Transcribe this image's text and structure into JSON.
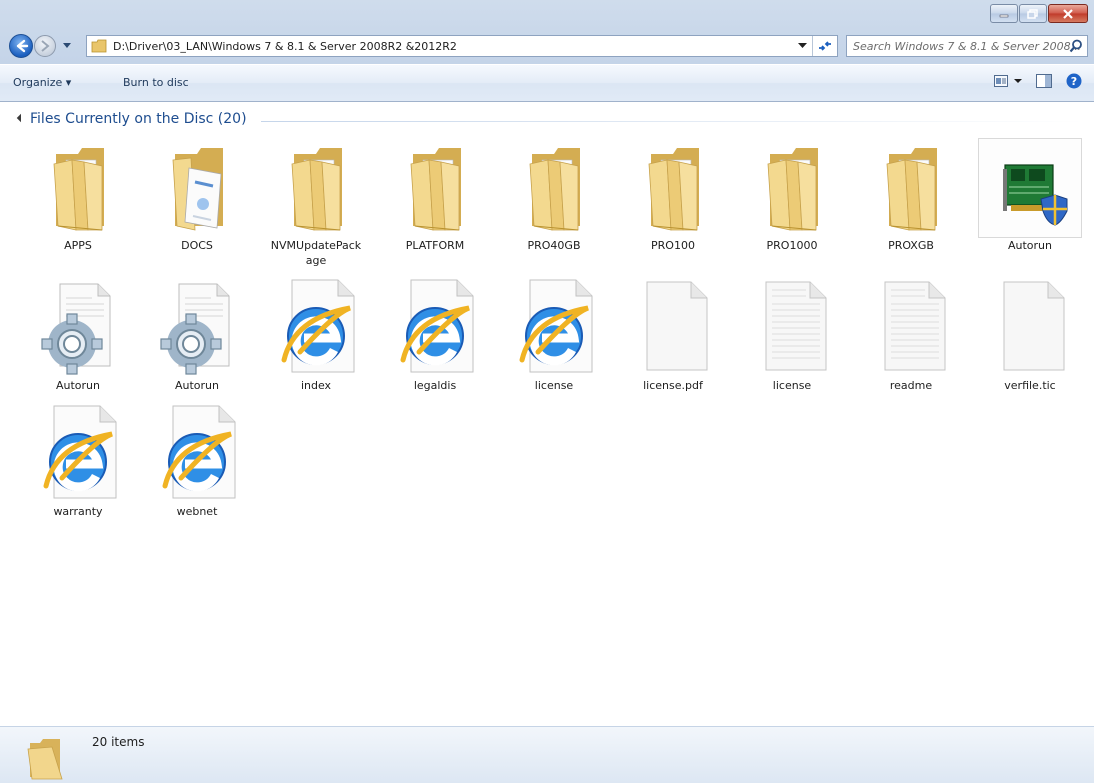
{
  "address": {
    "path": "D:\\Driver\\03_LAN\\Windows 7 & 8.1 & Server 2008R2 &2012R2",
    "search_placeholder": "Search Windows 7 & 8.1 & Server 2008..."
  },
  "toolbar": {
    "organize_label": "Organize ▾",
    "burn_label": "Burn to disc"
  },
  "group": {
    "title": "Files Currently on the Disc (20)"
  },
  "items": [
    {
      "label": "APPS",
      "icon": "folder-icon"
    },
    {
      "label": "DOCS",
      "icon": "folder-docs-icon"
    },
    {
      "label": "NVMUpdatePackage",
      "icon": "folder-icon"
    },
    {
      "label": "PLATFORM",
      "icon": "folder-icon"
    },
    {
      "label": "PRO40GB",
      "icon": "folder-icon"
    },
    {
      "label": "PRO100",
      "icon": "folder-icon"
    },
    {
      "label": "PRO1000",
      "icon": "folder-icon"
    },
    {
      "label": "PROXGB",
      "icon": "folder-icon"
    },
    {
      "label": "Autorun",
      "icon": "autorun-exe-icon"
    },
    {
      "label": "Autorun",
      "icon": "config-file-icon"
    },
    {
      "label": "Autorun",
      "icon": "config-file-icon"
    },
    {
      "label": "index",
      "icon": "ie-html-icon"
    },
    {
      "label": "legaldis",
      "icon": "ie-html-icon"
    },
    {
      "label": "license",
      "icon": "ie-html-icon"
    },
    {
      "label": "license.pdf",
      "icon": "blank-file-icon"
    },
    {
      "label": "license",
      "icon": "text-file-icon"
    },
    {
      "label": "readme",
      "icon": "text-file-icon"
    },
    {
      "label": "verfile.tic",
      "icon": "blank-file-icon"
    },
    {
      "label": "warranty",
      "icon": "ie-html-icon"
    },
    {
      "label": "webnet",
      "icon": "ie-html-icon"
    }
  ],
  "status": {
    "count": "20 items"
  }
}
